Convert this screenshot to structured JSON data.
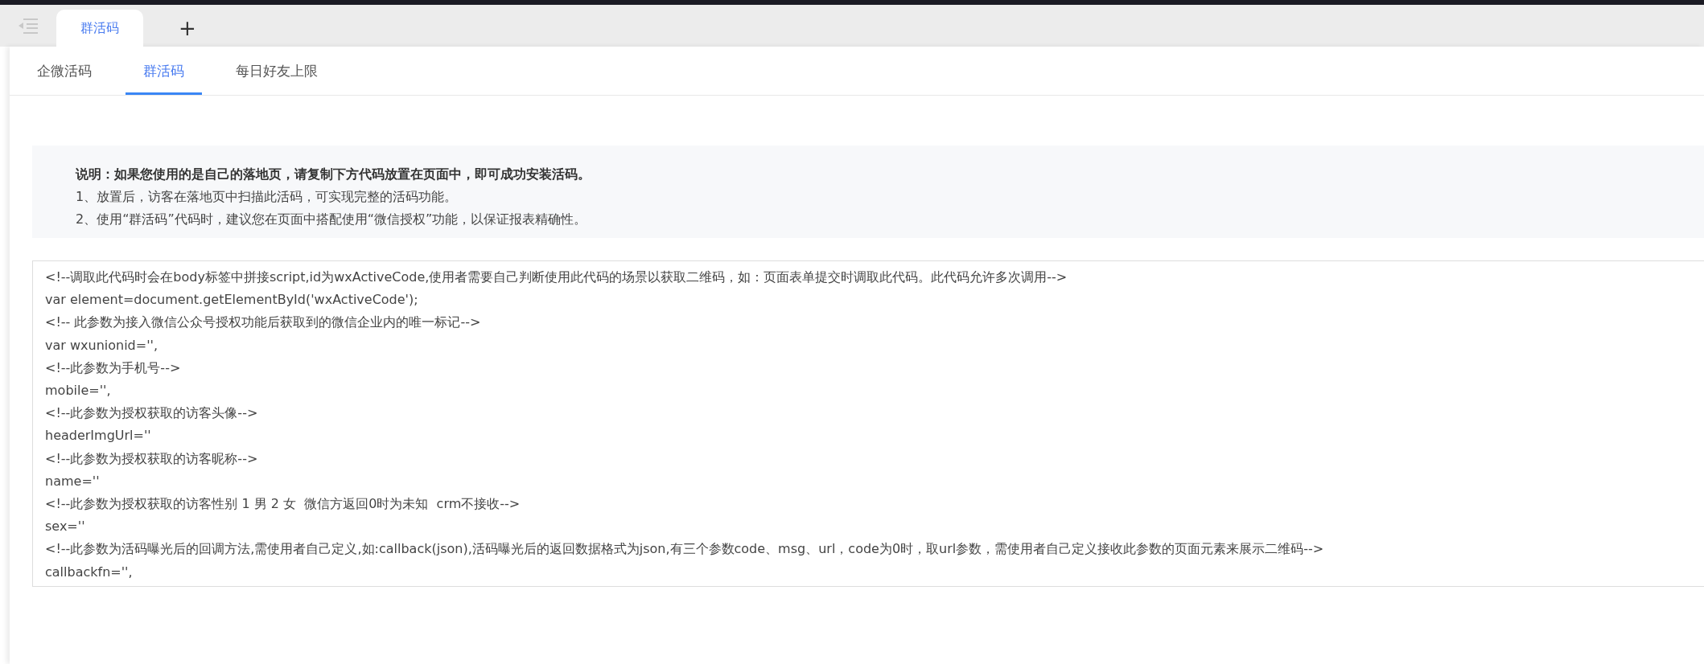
{
  "page_tabs": [
    {
      "label": "群活码",
      "selected": true
    }
  ],
  "add_tab": "+",
  "sub_tabs": [
    {
      "label": "企微活码",
      "selected": false
    },
    {
      "label": "群活码",
      "selected": true
    },
    {
      "label": "每日好友上限",
      "selected": false
    }
  ],
  "notice": {
    "title": "说明：如果您使用的是自己的落地页，请复制下方代码放置在页面中，即可成功安装活码。",
    "lines": [
      "1、放置后，访客在落地页中扫描此活码，可实现完整的活码功能。",
      "2、使用“群活码”代码时，建议您在页面中搭配使用“微信授权”功能，以保证报表精确性。"
    ]
  },
  "code_lines": [
    "<!--调取此代码时会在body标签中拼接script,id为wxActiveCode,使用者需要自己判断使用此代码的场景以获取二维码，如：页面表单提交时调取此代码。此代码允许多次调用-->",
    "var element=document.getElementById('wxActiveCode');",
    "<!-- 此参数为接入微信公众号授权功能后获取到的微信企业内的唯一标记-->",
    "var wxunionid='',",
    "<!--此参数为手机号-->",
    "mobile='',",
    "<!--此参数为授权获取的访客头像-->",
    "headerImgUrl=''",
    "<!--此参数为授权获取的访客昵称-->",
    "name=''",
    "<!--此参数为授权获取的访客性别 1 男 2 女  微信方返回0时为未知  crm不接收-->",
    "sex=''",
    "<!--此参数为活码曝光后的回调方法,需使用者自己定义,如:callback(json),活码曝光后的返回数据格式为json,有三个参数code、msg、url，code为0时，取url参数，需使用者自己定义接收此参数的页面元素来展示二维码-->",
    "callbackfn='',"
  ]
}
